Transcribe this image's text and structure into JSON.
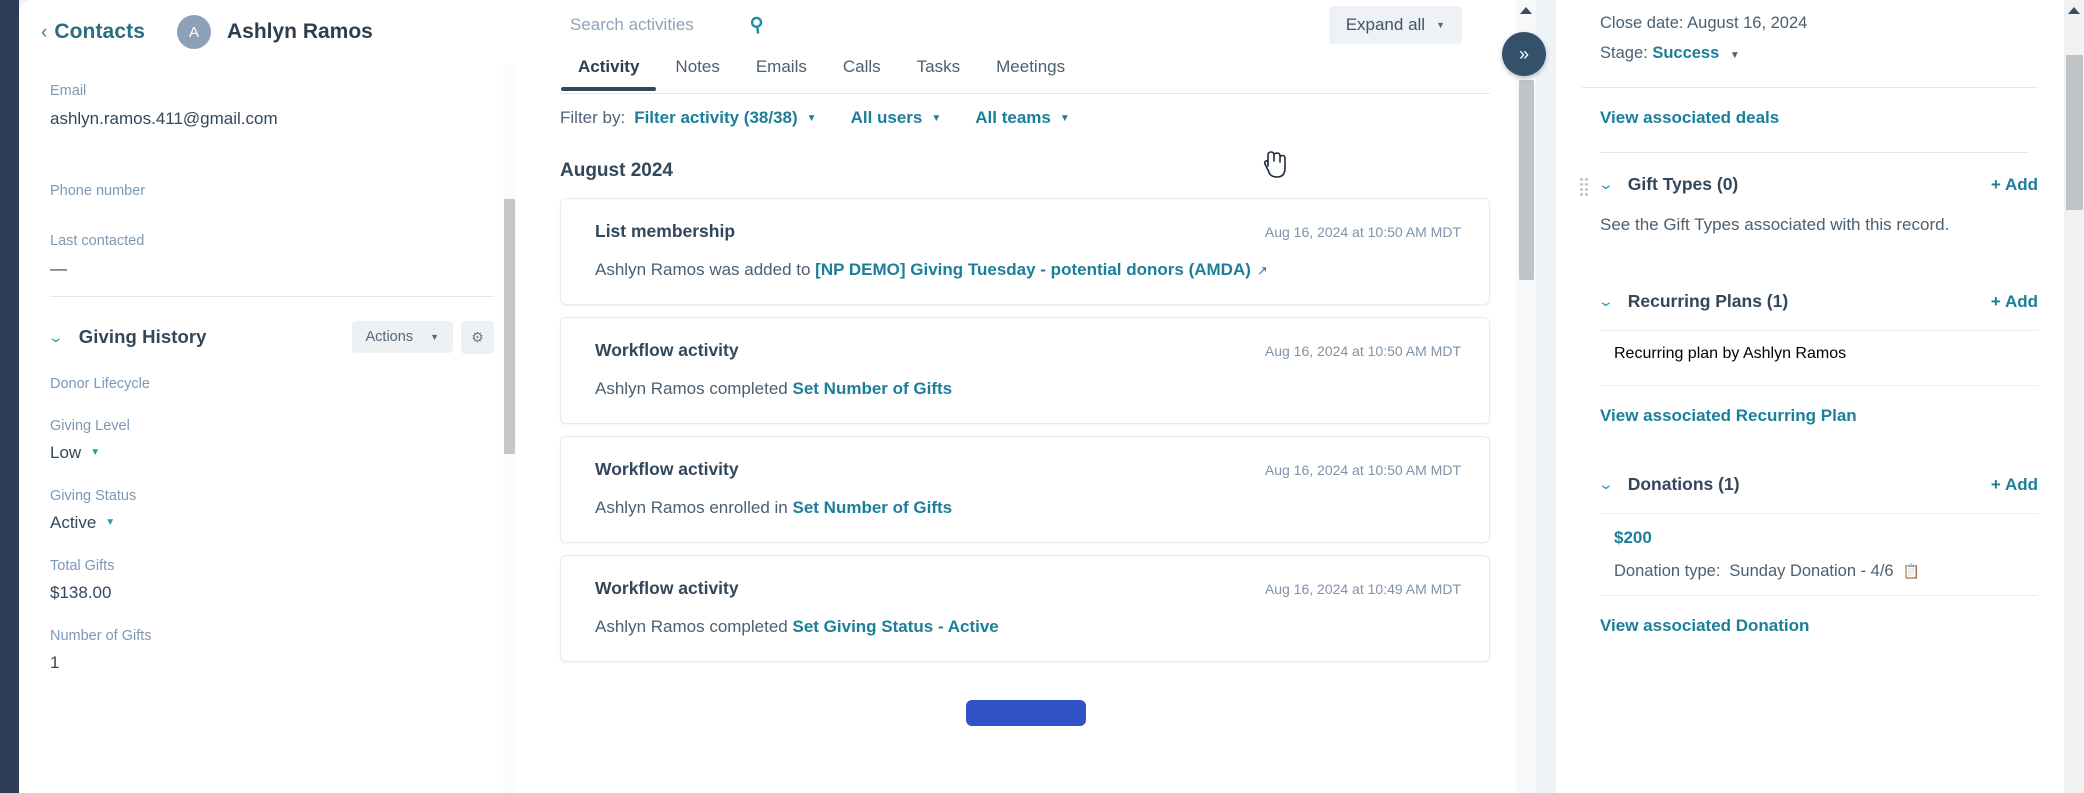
{
  "contact": {
    "back_label": "Contacts",
    "avatar_initial": "A",
    "name": "Ashlyn Ramos",
    "properties": [
      {
        "label": "Email",
        "value": "ashlyn.ramos.411@gmail.com"
      },
      {
        "label": "Phone number",
        "value": ""
      },
      {
        "label": "Last contacted",
        "value": "—"
      }
    ]
  },
  "giving_history": {
    "section_title": "Giving History",
    "actions_label": "Actions",
    "gear_icon": "gear-icon",
    "fields": [
      {
        "label": "Donor Lifecycle",
        "value": ""
      },
      {
        "label": "Giving Level",
        "value": "Low",
        "has_dropdown": true
      },
      {
        "label": "Giving Status",
        "value": "Active",
        "has_dropdown": true
      },
      {
        "label": "Total Gifts",
        "value": "$138.00"
      },
      {
        "label": "Number of Gifts",
        "value": "1"
      }
    ]
  },
  "center": {
    "search": {
      "placeholder": "Search activities",
      "value": "",
      "icon": "search-icon"
    },
    "expand_all_label": "Expand all",
    "tabs": [
      {
        "label": "Activity",
        "active": true
      },
      {
        "label": "Notes",
        "active": false
      },
      {
        "label": "Emails",
        "active": false
      },
      {
        "label": "Calls",
        "active": false
      },
      {
        "label": "Tasks",
        "active": false
      },
      {
        "label": "Meetings",
        "active": false
      }
    ],
    "filter": {
      "label": "Filter by:",
      "activity": "Filter activity (38/38)",
      "users": "All users",
      "teams": "All teams"
    },
    "month_header": "August 2024",
    "activities": [
      {
        "title": "List membership",
        "timestamp": "Aug 16, 2024 at 10:50 AM MDT",
        "text_before": "Ashlyn Ramos was added to ",
        "link": "[NP DEMO] Giving Tuesday - potential donors (AMDA)",
        "text_after": "",
        "external_link_icon": true
      },
      {
        "title": "Workflow activity",
        "timestamp": "Aug 16, 2024 at 10:50 AM MDT",
        "text_before": "Ashlyn Ramos completed ",
        "link": "Set Number of Gifts",
        "text_after": "",
        "external_link_icon": false
      },
      {
        "title": "Workflow activity",
        "timestamp": "Aug 16, 2024 at 10:50 AM MDT",
        "text_before": "Ashlyn Ramos enrolled in ",
        "link": "Set Number of Gifts",
        "text_after": "",
        "external_link_icon": false
      },
      {
        "title": "Workflow activity",
        "timestamp": "Aug 16, 2024 at 10:49 AM MDT",
        "text_before": "Ashlyn Ramos completed ",
        "link": "Set Giving Status - Active",
        "text_after": "",
        "external_link_icon": false
      }
    ],
    "collapse_icon": "chevron-double-right-icon"
  },
  "right": {
    "deal": {
      "close_date_label": "Close date:",
      "close_date_value": "August 16, 2024",
      "stage_label": "Stage:",
      "stage_value": "Success"
    },
    "view_associated_deals": "View associated deals",
    "gift_types": {
      "title": "Gift Types (0)",
      "add_label": "+ Add",
      "description": "See the Gift Types associated with this record."
    },
    "recurring_plans": {
      "title": "Recurring Plans (1)",
      "add_label": "+ Add",
      "item_link": "Recurring plan by Ashlyn Ramos",
      "view_link": "View associated Recurring Plan"
    },
    "donations": {
      "title": "Donations (1)",
      "add_label": "+ Add",
      "amount": "$200",
      "type_label": "Donation type:",
      "type_value": "Sunday Donation - 4/6",
      "copy_icon": "copy-icon",
      "view_link": "View associated Donation"
    }
  },
  "colors": {
    "brand_teal": "#1c7f99",
    "navy": "#33475b",
    "accent_blue": "#2f53c4",
    "rail": "#2c3e56"
  }
}
